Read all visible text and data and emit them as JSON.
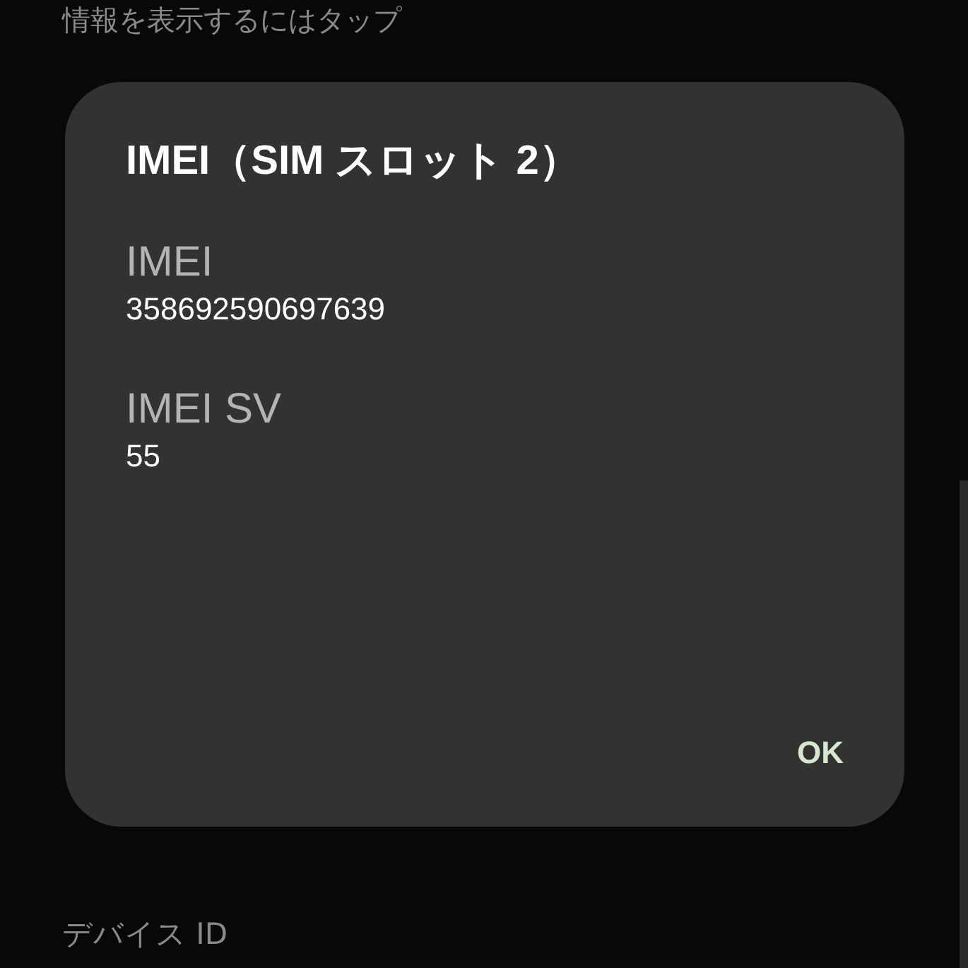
{
  "background": {
    "top_text": "情報を表示するにはタップ",
    "bottom_label": "デバイス ID"
  },
  "dialog": {
    "title": "IMEI（SIM スロット 2）",
    "fields": [
      {
        "label": "IMEI",
        "value": "358692590697639"
      },
      {
        "label": "IMEI SV",
        "value": "55"
      }
    ],
    "button": "OK"
  }
}
